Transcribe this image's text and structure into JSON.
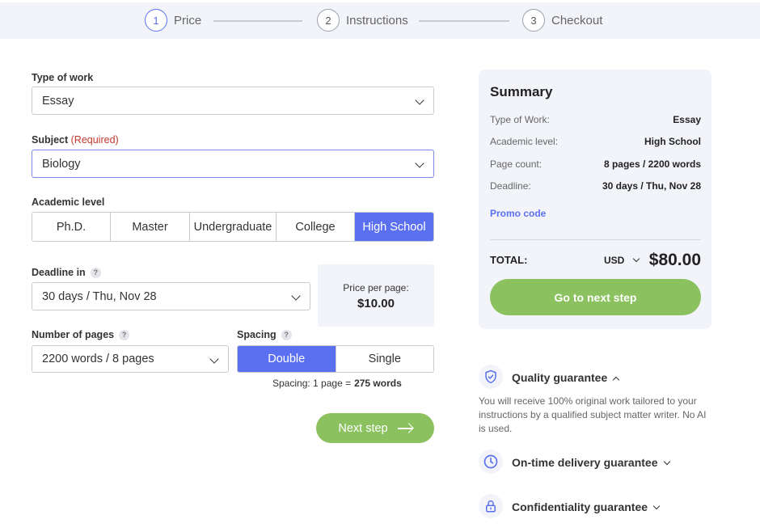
{
  "stepper": {
    "steps": [
      {
        "number": "1",
        "label": "Price",
        "active": true
      },
      {
        "number": "2",
        "label": "Instructions",
        "active": false
      },
      {
        "number": "3",
        "label": "Checkout",
        "active": false
      }
    ]
  },
  "form": {
    "type_of_work": {
      "label": "Type of work",
      "value": "Essay"
    },
    "subject": {
      "label": "Subject",
      "required": "(Required)",
      "value": "Biology"
    },
    "academic_level": {
      "label": "Academic level",
      "options": [
        "Ph.D.",
        "Master",
        "Undergraduate",
        "College",
        "High School"
      ],
      "selected": "High School"
    },
    "deadline": {
      "label": "Deadline in",
      "help": "?",
      "value": "30 days / Thu, Nov 28"
    },
    "price_per_page": {
      "label": "Price per page:",
      "value": "$10.00"
    },
    "pages": {
      "label": "Number of pages",
      "help": "?",
      "value": "2200 words / 8 pages"
    },
    "spacing": {
      "label": "Spacing",
      "help": "?",
      "options": [
        "Double",
        "Single"
      ],
      "selected": "Double",
      "note_prefix": "Spacing: 1 page =",
      "note_value": "275 words"
    },
    "next_button": "Next step"
  },
  "summary": {
    "title": "Summary",
    "rows": [
      {
        "key": "Type of Work:",
        "value": "Essay"
      },
      {
        "key": "Academic level:",
        "value": "High School"
      },
      {
        "key": "Page count:",
        "value": "8 pages / 2200 words"
      },
      {
        "key": "Deadline:",
        "value": "30 days / Thu, Nov 28"
      }
    ],
    "promo": "Promo code",
    "total_label": "TOTAL:",
    "currency": "USD",
    "total_value": "$80.00",
    "button": "Go to next step"
  },
  "guarantees": [
    {
      "title": "Quality guarantee",
      "icon": "shield-check-icon",
      "expanded": true,
      "text": "You will receive 100% original work tailored to your instructions by a qualified subject matter writer. No AI is used."
    },
    {
      "title": "On-time delivery guarantee",
      "icon": "clock-icon",
      "expanded": false
    },
    {
      "title": "Confidentiality guarantee",
      "icon": "lock-icon",
      "expanded": false
    }
  ],
  "colors": {
    "accent": "#5b70f0",
    "green": "#8bc15e",
    "panel": "#f2f4f9"
  }
}
